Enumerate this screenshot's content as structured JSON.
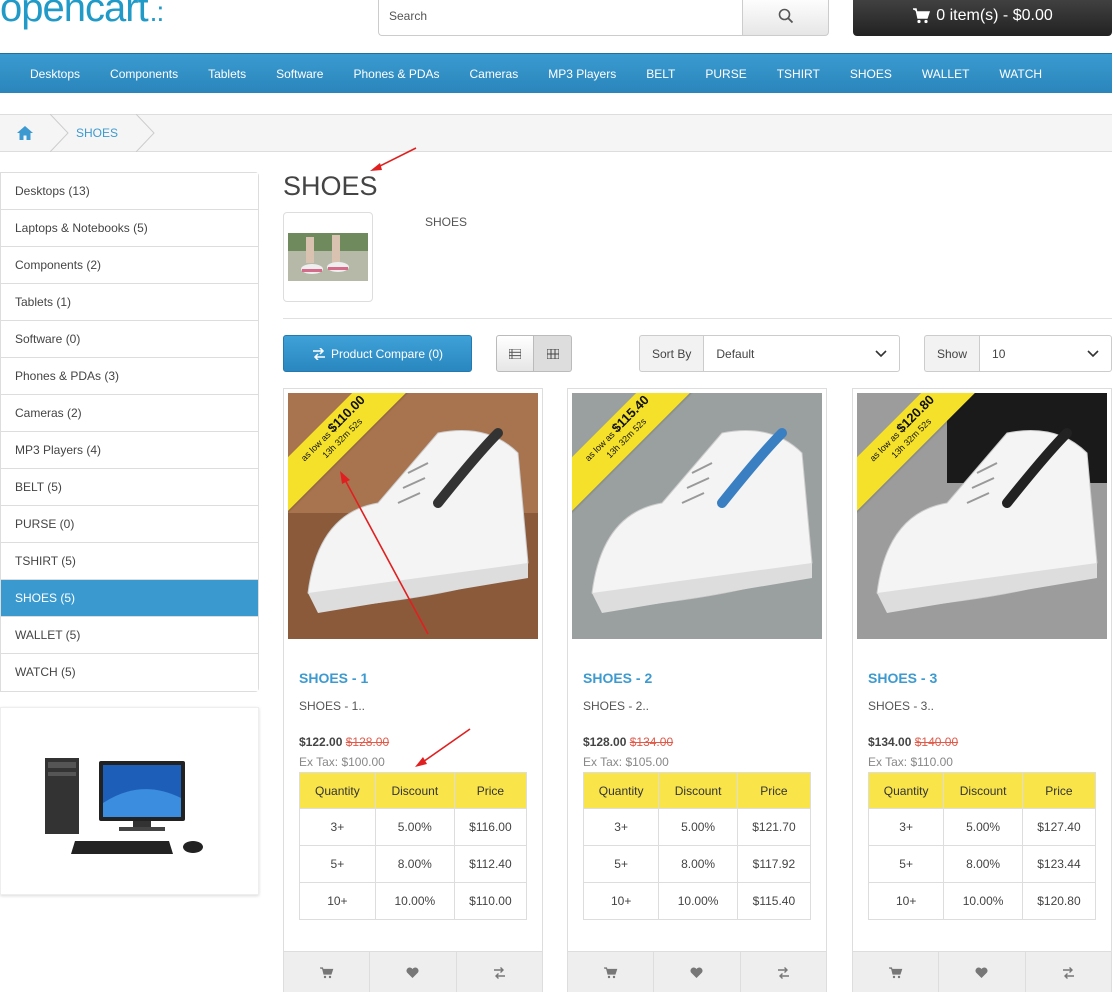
{
  "header": {
    "logo_text": "opencart",
    "logo_dots": ".:",
    "search_placeholder": "Search",
    "cart_label": "0 item(s) - $0.00"
  },
  "menu": [
    "Desktops",
    "Components",
    "Tablets",
    "Software",
    "Phones & PDAs",
    "Cameras",
    "MP3 Players",
    "BELT",
    "PURSE",
    "TSHIRT",
    "SHOES",
    "WALLET",
    "WATCH"
  ],
  "breadcrumb": {
    "current": "SHOES"
  },
  "sidebar": {
    "items": [
      {
        "label": "Desktops (13)",
        "active": false
      },
      {
        "label": "Laptops & Notebooks (5)",
        "active": false
      },
      {
        "label": "Components (2)",
        "active": false
      },
      {
        "label": "Tablets (1)",
        "active": false
      },
      {
        "label": "Software (0)",
        "active": false
      },
      {
        "label": "Phones & PDAs (3)",
        "active": false
      },
      {
        "label": "Cameras (2)",
        "active": false
      },
      {
        "label": "MP3 Players (4)",
        "active": false
      },
      {
        "label": "BELT (5)",
        "active": false
      },
      {
        "label": "PURSE (0)",
        "active": false
      },
      {
        "label": "TSHIRT (5)",
        "active": false
      },
      {
        "label": "SHOES (5)",
        "active": true
      },
      {
        "label": "WALLET (5)",
        "active": false
      },
      {
        "label": "WATCH (5)",
        "active": false
      }
    ]
  },
  "category": {
    "title": "SHOES",
    "description": "SHOES"
  },
  "toolbar": {
    "compare_label": "Product Compare (0)",
    "sort_label": "Sort By",
    "sort_value": "Default",
    "show_label": "Show",
    "show_value": "10"
  },
  "table_headers": [
    "Quantity",
    "Discount",
    "Price"
  ],
  "products": [
    {
      "name": "SHOES - 1",
      "desc": "SHOES - 1..",
      "price": "$122.00",
      "old_price": "$128.00",
      "ex_tax": "Ex Tax: $100.00",
      "ribbon_prefix": "as low as",
      "ribbon_price": "$110.00",
      "ribbon_timer": "13h 32m 52s",
      "discounts": [
        [
          "3+",
          "5.00%",
          "$116.00"
        ],
        [
          "5+",
          "8.00%",
          "$112.40"
        ],
        [
          "10+",
          "10.00%",
          "$110.00"
        ]
      ]
    },
    {
      "name": "SHOES - 2",
      "desc": "SHOES - 2..",
      "price": "$128.00",
      "old_price": "$134.00",
      "ex_tax": "Ex Tax: $105.00",
      "ribbon_prefix": "as low as",
      "ribbon_price": "$115.40",
      "ribbon_timer": "13h 32m 52s",
      "discounts": [
        [
          "3+",
          "5.00%",
          "$121.70"
        ],
        [
          "5+",
          "8.00%",
          "$117.92"
        ],
        [
          "10+",
          "10.00%",
          "$115.40"
        ]
      ]
    },
    {
      "name": "SHOES - 3",
      "desc": "SHOES - 3..",
      "price": "$134.00",
      "old_price": "$140.00",
      "ex_tax": "Ex Tax: $110.00",
      "ribbon_prefix": "as low as",
      "ribbon_price": "$120.80",
      "ribbon_timer": "13h 32m 52s",
      "discounts": [
        [
          "3+",
          "5.00%",
          "$127.40"
        ],
        [
          "5+",
          "8.00%",
          "$123.44"
        ],
        [
          "10+",
          "10.00%",
          "$120.80"
        ]
      ]
    }
  ],
  "colors": {
    "brand": "#229ac8",
    "active": "#3a9ad0",
    "ribbon": "#f5e12a",
    "table_header": "#f9e44a",
    "old_price": "#e05a4a",
    "annotation": "#e02020"
  }
}
